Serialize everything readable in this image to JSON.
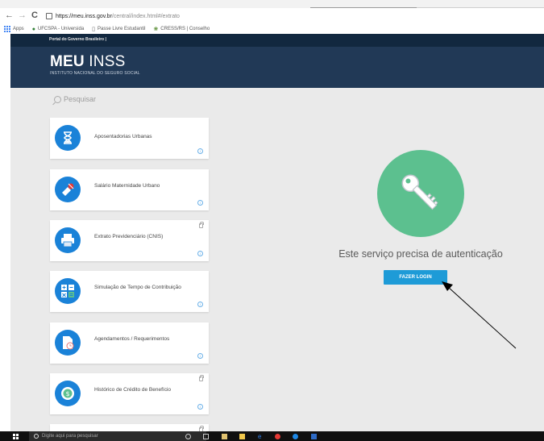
{
  "browser": {
    "nav": {
      "back": "←",
      "forward": "→",
      "reload": "C"
    },
    "url_host": "https://meu.inss.gov.br",
    "url_path": "/central/index.html#/extrato",
    "bookmarks": [
      {
        "label": "Apps",
        "icon": "apps-grid-icon"
      },
      {
        "label": "UFCSPA - Universida",
        "icon": "ufcspa-icon"
      },
      {
        "label": "Passe Livre Estudantil",
        "icon": "page-icon"
      },
      {
        "label": "CRESS/RS | Conselho",
        "icon": "cress-icon"
      }
    ]
  },
  "gov_strip": {
    "label": "Portal do Governo Brasileiro |"
  },
  "header": {
    "title_bold": "MEU",
    "title_light": " INSS",
    "subtitle": "INSTITUTO NACIONAL DO SEGURO SOCIAL"
  },
  "search": {
    "placeholder": "Pesquisar"
  },
  "services": [
    {
      "label": "Aposentadorias Urbanas",
      "icon": "hourglass-icon",
      "locked": false
    },
    {
      "label": "Salário Maternidade Urbano",
      "icon": "baby-icon",
      "locked": false
    },
    {
      "label": "Extrato Previdenciário (CNIS)",
      "icon": "printer-icon",
      "locked": true
    },
    {
      "label": "Simulação de Tempo de Contribuição",
      "icon": "calculator-icon",
      "locked": false
    },
    {
      "label": "Agendamentos / Requerimentos",
      "icon": "document-clock-icon",
      "locked": false
    },
    {
      "label": "Histórico de Crédito de Benefício",
      "icon": "dollar-coin-icon",
      "locked": true
    }
  ],
  "auth": {
    "message": "Este serviço precisa de autenticação",
    "login_button": "FAZER LOGIN",
    "icon": "key-icon"
  },
  "taskbar": {
    "search_placeholder": "Digite aqui para pesquisar"
  },
  "colors": {
    "header_bg": "#213956",
    "gov_strip_bg": "#12283f",
    "card_icon_bg": "#1a82d8",
    "key_circle_bg": "#5cc08f",
    "login_button_bg": "#1e9bd7",
    "page_bg": "#eaeaea"
  }
}
